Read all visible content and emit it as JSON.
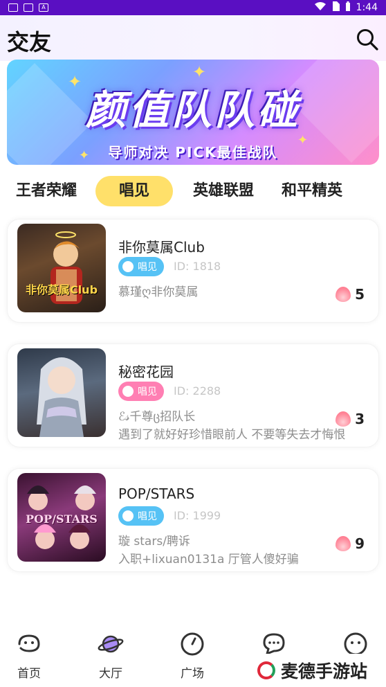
{
  "status_bar": {
    "time": "1:44"
  },
  "header": {
    "title": "交友",
    "search_icon": "search-icon"
  },
  "banner": {
    "title": "颜值队队碰",
    "subtitle": "导师对决 PICK最佳战队"
  },
  "tabs": [
    {
      "label": "王者荣耀",
      "active": false
    },
    {
      "label": "唱见",
      "active": true
    },
    {
      "label": "英雄联盟",
      "active": false
    },
    {
      "label": "和平精英",
      "active": false
    }
  ],
  "rooms": [
    {
      "name": "非你莫属Club",
      "badge": "唱见",
      "badge_color": "#56c2f5",
      "id": "ID: 1818",
      "owner": "慕瑾ღ非你莫属",
      "desc": "",
      "heat": "5",
      "thumb_text": "非你莫属Club"
    },
    {
      "name": "秘密花园",
      "badge": "唱见",
      "badge_color": "#ff7fb3",
      "id": "ID: 2288",
      "owner": "ℰ𝓈千尊ც招队长",
      "desc": "遇到了就好好珍惜眼前人 不要等失去才悔恨",
      "heat": "3",
      "thumb_text": ""
    },
    {
      "name": "POP/STARS",
      "badge": "唱见",
      "badge_color": "#56c2f5",
      "id": "ID: 1999",
      "owner": "璇 stars/聘诉",
      "desc": "入职+lixuan0131a 厅管人傻好骗",
      "heat": "9",
      "thumb_text": "POP/STARS"
    }
  ],
  "bottom_nav": [
    {
      "label": "首页",
      "icon": "home-icon"
    },
    {
      "label": "大厅",
      "icon": "planet-icon"
    },
    {
      "label": "广场",
      "icon": "compass-icon"
    },
    {
      "label": "",
      "icon": "message-icon"
    },
    {
      "label": "",
      "icon": "profile-icon"
    }
  ],
  "watermark": {
    "text": "麦德手游站"
  }
}
